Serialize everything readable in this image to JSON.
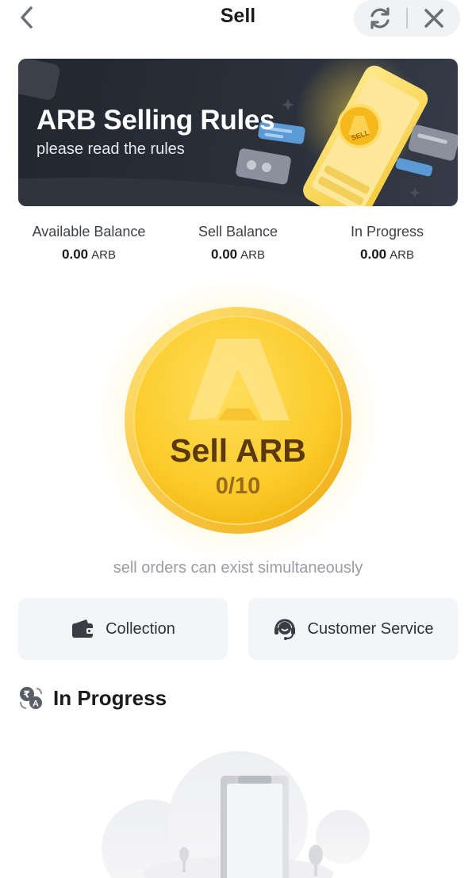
{
  "header": {
    "title": "Sell",
    "icons": {
      "back": "chevron-left-icon",
      "refresh": "refresh-icon",
      "close": "close-icon"
    }
  },
  "banner": {
    "title": "ARB Selling Rules",
    "subtitle": "please read the rules",
    "coin_label": "SELL"
  },
  "balances": [
    {
      "label": "Available Balance",
      "value": "0.00",
      "unit": "ARB"
    },
    {
      "label": "Sell Balance",
      "value": "0.00",
      "unit": "ARB"
    },
    {
      "label": "In Progress",
      "value": "0.00",
      "unit": "ARB"
    }
  ],
  "sell_button": {
    "label": "Sell ARB",
    "count": "0/10"
  },
  "note": "sell orders can exist simultaneously",
  "actions": {
    "collection": {
      "label": "Collection",
      "icon": "wallet-icon"
    },
    "customer_service": {
      "label": "Customer Service",
      "icon": "headset-icon"
    }
  },
  "section": {
    "title": "In Progress",
    "icon": "currency-exchange-icon"
  },
  "colors": {
    "accent_gold": "#f7c325",
    "banner_bg": "#262a33",
    "card_bg": "#f4f5f8"
  }
}
